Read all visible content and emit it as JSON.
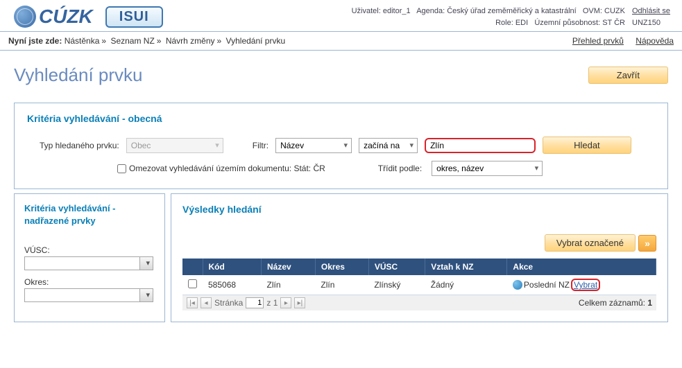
{
  "header": {
    "cuzk": "CÚZK",
    "isui": "ISUI",
    "user_label": "Uživatel:",
    "user": "editor_1",
    "agenda_label": "Agenda:",
    "agenda": "Český úřad zeměměřický a katastrální",
    "ovm_label": "OVM:",
    "ovm": "CUZK",
    "role_label": "Role:",
    "role": "EDI",
    "territory_label": "Územní působnost:",
    "territory": "ST ČR",
    "logout": "Odhlásit se",
    "env": "UNZ150"
  },
  "breadcrumb": {
    "prefix": "Nyní jste zde:",
    "items": [
      "Nástěnka",
      "Seznam NZ",
      "Návrh změny",
      "Vyhledání prvku"
    ],
    "links": {
      "overview": "Přehled prvků",
      "help": "Nápověda"
    }
  },
  "page": {
    "title": "Vyhledání prvku",
    "close": "Zavřít"
  },
  "criteria": {
    "title": "Kritéria vyhledávání - obecná",
    "type_label": "Typ hledaného prvku:",
    "type_value": "Obec",
    "filter_label": "Filtr:",
    "filter_attr": "Název",
    "filter_op": "začíná na",
    "filter_value": "Zlín",
    "search_btn": "Hledat",
    "restrict_label": "Omezovat vyhledávání územím dokumentu: Stát: ČR",
    "sort_label": "Třídit podle:",
    "sort_value": "okres, název"
  },
  "left": {
    "title": "Kritéria vyhledávání - nadřazené prvky",
    "vusc_label": "VÚSC:",
    "okres_label": "Okres:"
  },
  "results": {
    "title": "Výsledky hledání",
    "select_btn": "Vybrat označené",
    "columns": [
      "",
      "Kód",
      "Název",
      "Okres",
      "VÚSC",
      "Vztah k NZ",
      "Akce"
    ],
    "rows": [
      {
        "kod": "585068",
        "nazev": "Zlín",
        "okres": "Zlín",
        "vusc": "Zlínský",
        "vztah": "Žádný",
        "akce_link1": "Poslední NZ",
        "akce_link2": "Vybrat"
      }
    ],
    "pager": {
      "page_label": "Stránka",
      "page": "1",
      "of_label": "z 1",
      "total_label": "Celkem záznamů:",
      "total": "1"
    }
  }
}
